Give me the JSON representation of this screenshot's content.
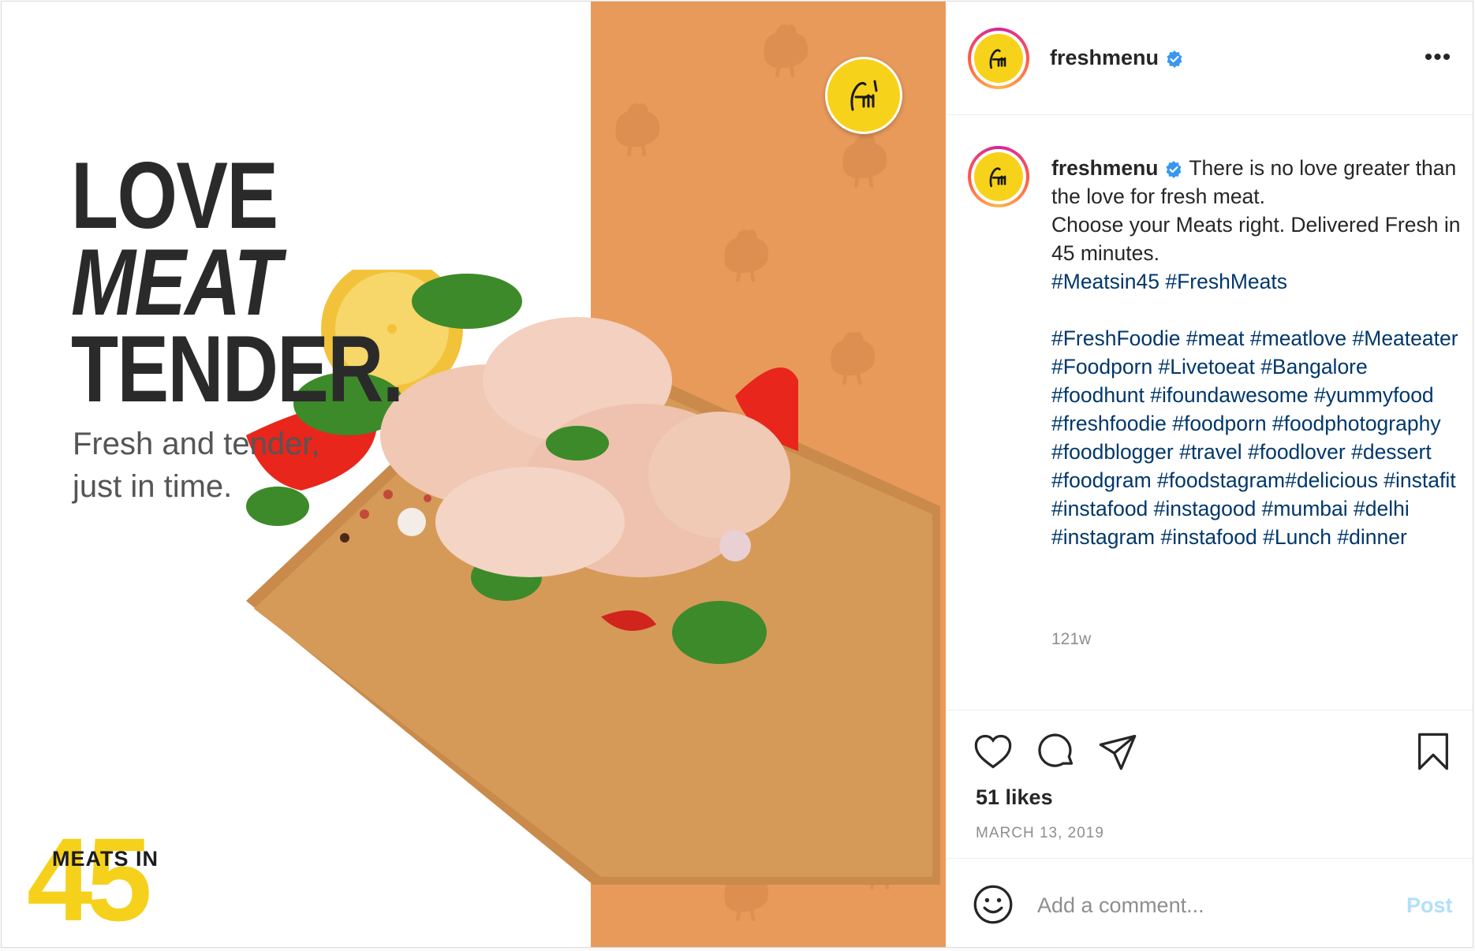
{
  "media": {
    "headline": [
      "LOVE",
      "MEAT",
      "TENDER."
    ],
    "subline": "Fresh and tender, just in time.",
    "badge_label": "MEATS IN",
    "badge_number": "45",
    "colors": {
      "panel": "#e89a5b",
      "logo": "#f7d21a",
      "badge": "#f5d11b"
    }
  },
  "header": {
    "username": "freshmenu",
    "verified_icon": "verified-badge-icon",
    "more_icon": "more-options-icon",
    "more_label": "•••"
  },
  "caption": {
    "username": "freshmenu",
    "text_lines": [
      "There is no love greater than the love for fresh meat.",
      "Choose your Meats right. Delivered Fresh in 45 minutes."
    ],
    "hashtags_1": "#Meatsin45 #FreshMeats",
    "hashtags_2": "#FreshFoodie #meat #meatlove #Meateater #Foodporn #Livetoeat #Bangalore #foodhunt #ifoundawesome #yummyfood #freshfoodie #foodporn #foodphotography #foodblogger #travel #foodlover #dessert #foodgram #foodstagram#delicious #instafit #instafood #instagood #mumbai #delhi #instagram #instafood #Lunch #dinner",
    "time_ago": "121w"
  },
  "actions": {
    "icons": [
      "heart-icon",
      "comment-icon",
      "share-icon",
      "bookmark-icon"
    ],
    "likes": "51 likes",
    "date": "MARCH 13, 2019"
  },
  "comment": {
    "placeholder": "Add a comment...",
    "post_label": "Post",
    "emoji_icon": "emoji-icon"
  },
  "theme": {
    "link": "#00376b",
    "muted": "#8e8e8e",
    "verified": "#3897f0",
    "post_disabled": "#b2dffc"
  }
}
